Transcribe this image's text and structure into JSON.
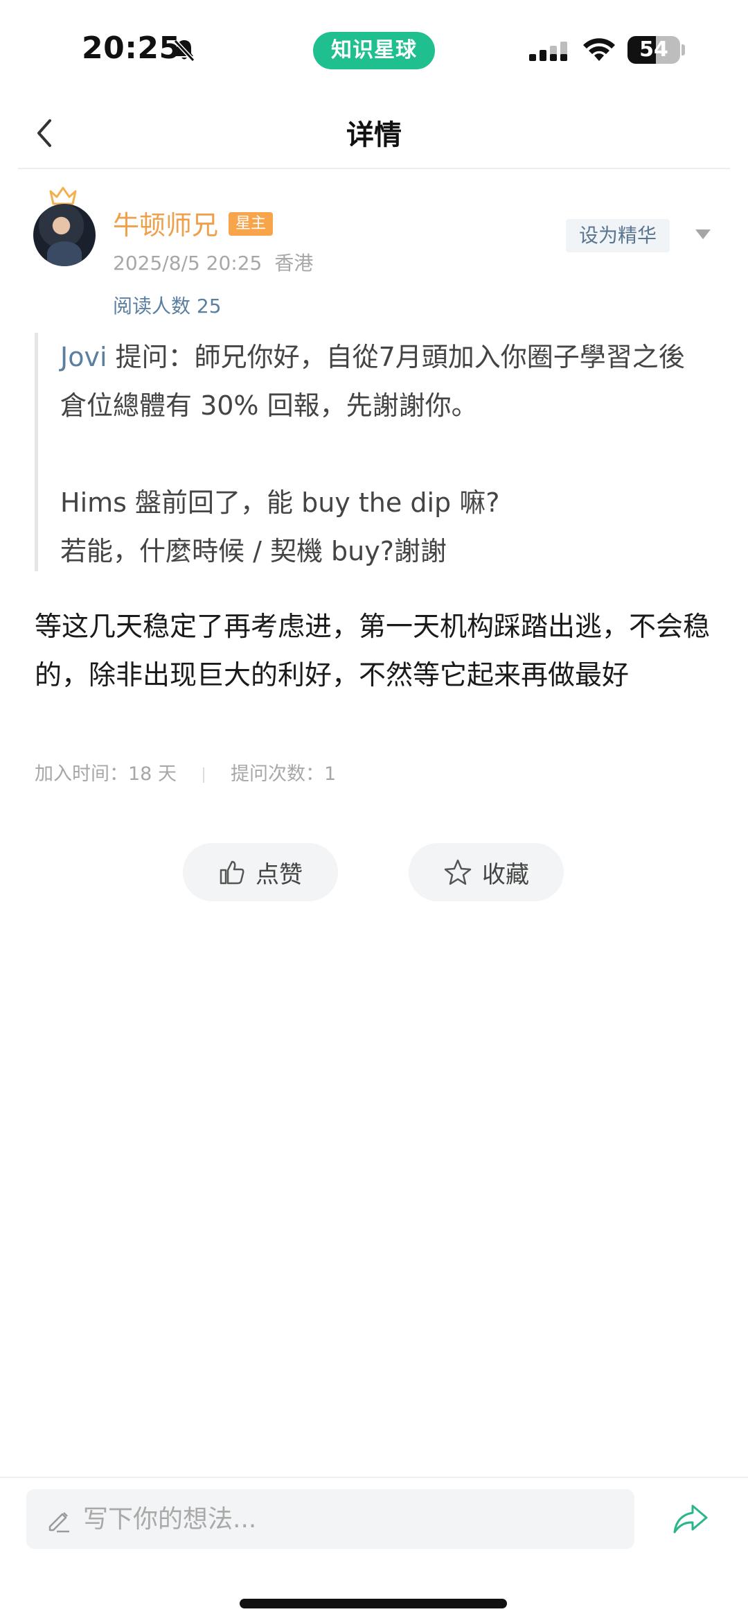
{
  "status_bar": {
    "time": "20:25",
    "app_pill": "知识星球",
    "battery": "54",
    "battery_level": 0.54
  },
  "nav": {
    "title": "详情"
  },
  "author": {
    "name": "牛顿师兄",
    "badge": "星主",
    "date": "2025/8/5 20:25",
    "location": "香港",
    "read_count": "阅读人数 25",
    "feature_label": "设为精华"
  },
  "question": {
    "asker": "Jovi",
    "text": " 提问：師兄你好，自從7月頭加入你圈子學習之後倉位總體有 30% 回報，先謝謝你。\n\nHims 盤前回了，能 buy the dip 嘛?\n若能，什麼時候 / 契機 buy?謝謝"
  },
  "answer": {
    "text": "等这几天稳定了再考虑进，第一天机构踩踏出逃，不会稳的，除非出现巨大的利好，不然等它起来再做最好",
    "join_time": "加入时间：18 天",
    "question_count": "提问次数：1"
  },
  "actions": {
    "like_label": "点赞",
    "favorite_label": "收藏"
  },
  "composer": {
    "placeholder": "写下你的想法..."
  },
  "colors": {
    "brand_green": "#1fbf8f",
    "author_orange": "#f0a04b",
    "link_blue": "#5b7fa0"
  },
  "icons": [
    "bell-muted-icon",
    "signal-icon",
    "wifi-icon",
    "battery-icon",
    "back-chevron-icon",
    "crown-icon",
    "dropdown-arrow-icon",
    "thumbs-up-icon",
    "star-icon",
    "pen-icon",
    "share-icon"
  ]
}
